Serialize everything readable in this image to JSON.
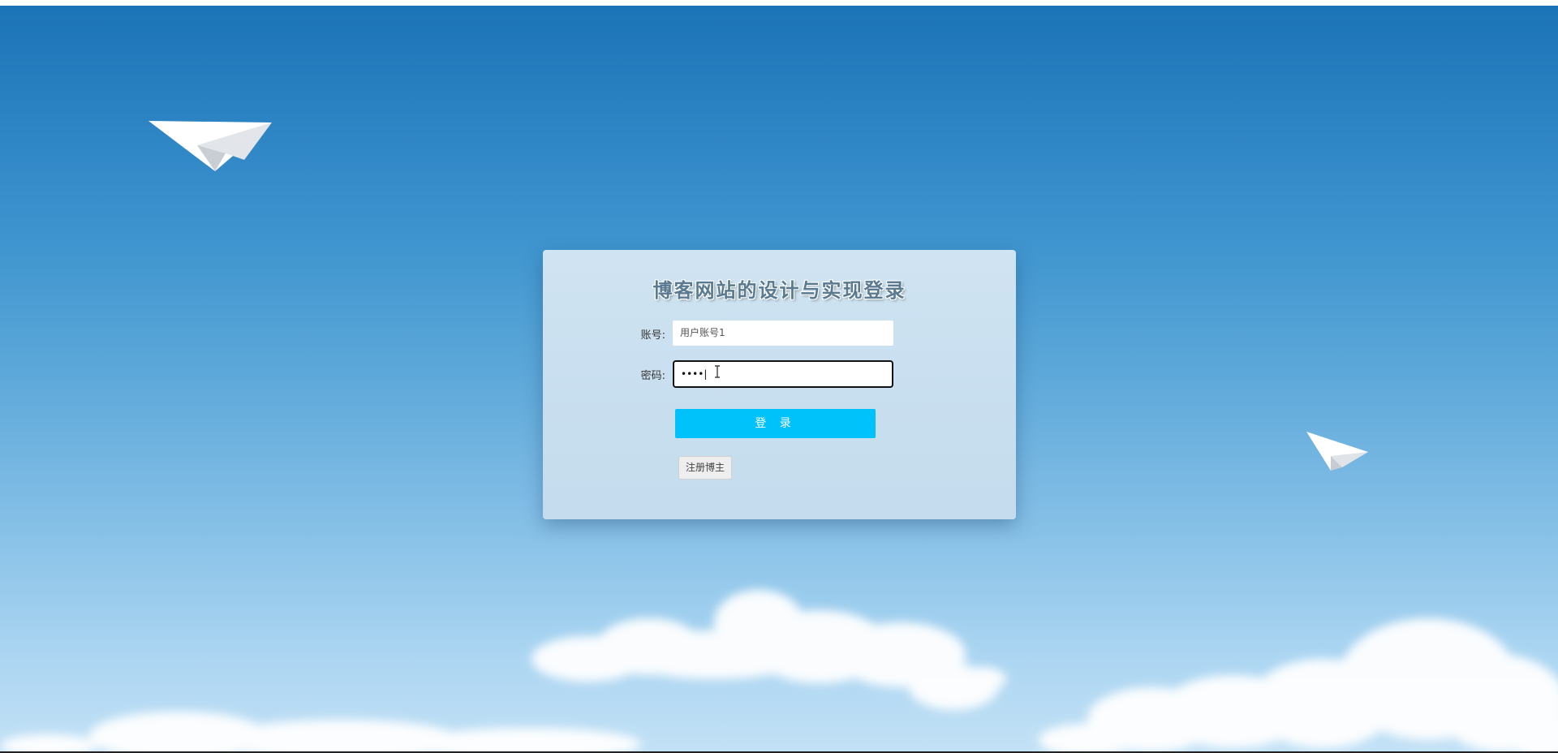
{
  "page": {
    "title": "博客网站的设计与实现登录"
  },
  "form": {
    "account_label": "账号:",
    "account_value": "用户账号1",
    "password_label": "密码:",
    "password_value": "••••|",
    "login_label": "登 录",
    "register_label": "注册博主"
  },
  "icons": {
    "plane_large": "paper-plane-icon",
    "plane_small": "paper-plane-icon",
    "text_cursor": "text-cursor-icon"
  },
  "colors": {
    "login_button": "#00c2fa",
    "sky_top": "#1b74b7",
    "sky_bottom": "#c3e1f6"
  }
}
